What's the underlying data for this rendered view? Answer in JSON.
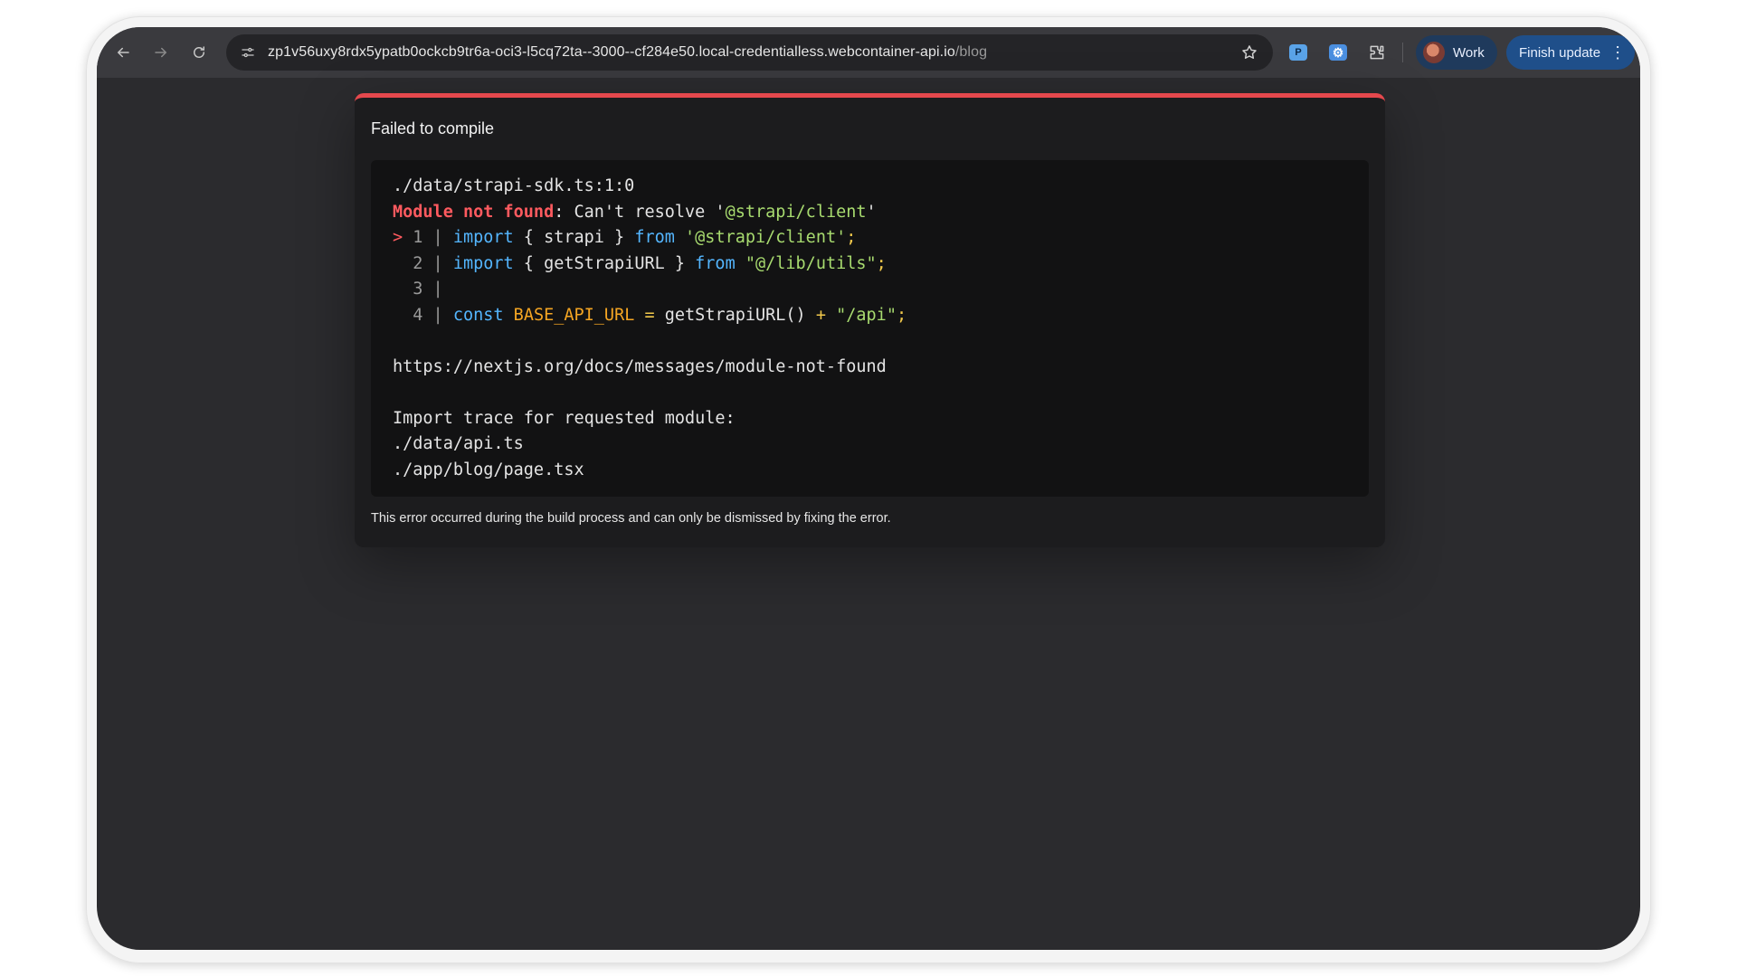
{
  "browser": {
    "url_host": "zp1v56uxy8rdx5ypatb0ockcb9tr6a-oci3-l5cq72ta--3000--cf284e50.local-credentialless.webcontainer-api.io",
    "url_path": "/blog",
    "profile_label": "Work",
    "update_label": "Finish update",
    "ext1": "P",
    "ext2": "⚙"
  },
  "error": {
    "title": "Failed to compile",
    "file_ref": "./data/strapi-sdk.ts:1:0",
    "error_kind": "Module not found",
    "error_msg_prefix": ": Can't resolve '",
    "error_module": "@strapi/client",
    "error_msg_suffix": "'",
    "lines": [
      {
        "marker": "> ",
        "num": "1",
        "kw1": "import",
        "mid1": " { strapi } ",
        "kw2": "from",
        "str": " '@strapi/client'",
        "end": ";"
      },
      {
        "marker": "  ",
        "num": "2",
        "kw1": "import",
        "mid1": " { getStrapiURL } ",
        "kw2": "from",
        "str": " \"@/lib/utils\"",
        "end": ";"
      },
      {
        "marker": "  ",
        "num": "3"
      },
      {
        "marker": "  ",
        "num": "4",
        "kw1": "const",
        "const_name": " BASE_API_URL",
        "op1": " = ",
        "call": "getStrapiURL()",
        "op2": " + ",
        "str": "\"/api\"",
        "end": ";"
      }
    ],
    "docs_link": "https://nextjs.org/docs/messages/module-not-found",
    "trace_heading": "Import trace for requested module:",
    "trace": [
      "./data/api.ts",
      "./app/blog/page.tsx"
    ],
    "footer": "This error occurred during the build process and can only be dismissed by fixing the error."
  }
}
